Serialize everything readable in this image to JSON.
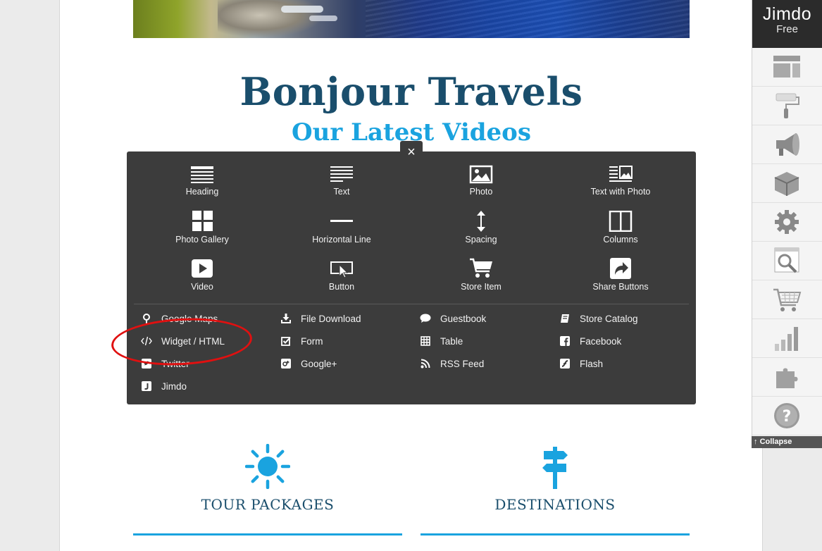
{
  "site": {
    "title": "Bonjour Travels",
    "subtitle": "Our Latest Videos"
  },
  "panel": {
    "close_symbol": "×",
    "tiles": [
      {
        "label": "Heading",
        "icon": "heading-icon"
      },
      {
        "label": "Text",
        "icon": "text-icon"
      },
      {
        "label": "Photo",
        "icon": "photo-icon"
      },
      {
        "label": "Text with Photo",
        "icon": "text-with-photo-icon"
      },
      {
        "label": "Photo Gallery",
        "icon": "photo-gallery-icon"
      },
      {
        "label": "Horizontal Line",
        "icon": "horizontal-line-icon"
      },
      {
        "label": "Spacing",
        "icon": "spacing-icon"
      },
      {
        "label": "Columns",
        "icon": "columns-icon"
      },
      {
        "label": "Video",
        "icon": "video-icon"
      },
      {
        "label": "Button",
        "icon": "button-icon"
      },
      {
        "label": "Store Item",
        "icon": "cart-icon"
      },
      {
        "label": "Share Buttons",
        "icon": "share-icon"
      }
    ],
    "list": [
      {
        "label": "Google Maps",
        "icon": "map-pin-icon"
      },
      {
        "label": "Widget / HTML",
        "icon": "code-icon"
      },
      {
        "label": "Twitter",
        "icon": "twitter-icon"
      },
      {
        "label": "Jimdo",
        "icon": "jimdo-icon"
      },
      {
        "label": "File Download",
        "icon": "download-icon"
      },
      {
        "label": "Form",
        "icon": "checkbox-icon"
      },
      {
        "label": "Google+",
        "icon": "google-plus-icon"
      },
      {
        "label": "Guestbook",
        "icon": "speech-bubble-icon"
      },
      {
        "label": "Table",
        "icon": "table-icon"
      },
      {
        "label": "RSS Feed",
        "icon": "rss-icon"
      },
      {
        "label": "Store Catalog",
        "icon": "catalog-icon"
      },
      {
        "label": "Facebook",
        "icon": "facebook-icon"
      },
      {
        "label": "Flash",
        "icon": "flash-icon"
      }
    ]
  },
  "features": [
    {
      "title": "TOUR PACKAGES",
      "icon": "sun-icon"
    },
    {
      "title": "DESTINATIONS",
      "icon": "signpost-icon"
    }
  ],
  "jimdo_bar": {
    "brand": "Jimdo",
    "plan": "Free",
    "collapse_label": "Collapse",
    "buttons": [
      "layout-icon",
      "paint-roller-icon",
      "megaphone-icon",
      "package-icon",
      "gear-icon",
      "seo-icon",
      "shopping-cart-icon",
      "statistics-icon",
      "puzzle-icon",
      "help-icon"
    ]
  },
  "colors": {
    "accent": "#1aa3df",
    "title": "#1a4e6c",
    "panel_bg": "#3c3c3c",
    "annotation": "#e01010"
  }
}
